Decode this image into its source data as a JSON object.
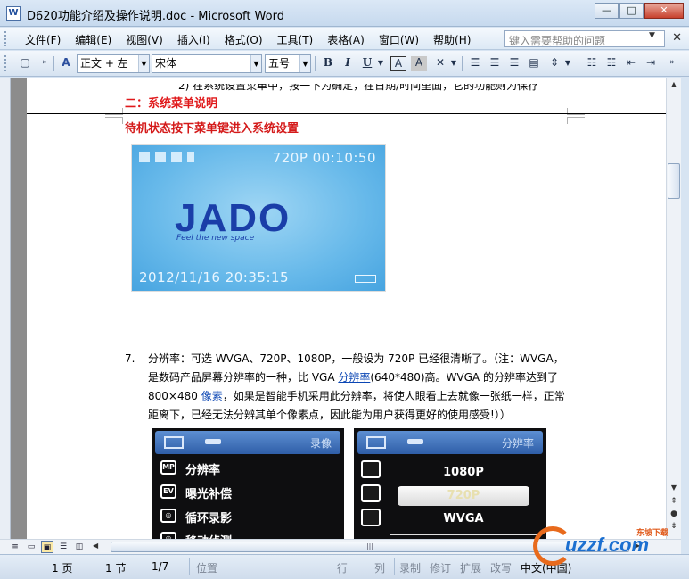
{
  "window": {
    "title": "D620功能介绍及操作说明.doc - Microsoft Word",
    "app_icon": "W",
    "buttons": {
      "minimize": "—",
      "maximize": "□",
      "close": "✕"
    }
  },
  "menubar": {
    "items": [
      "文件(F)",
      "编辑(E)",
      "视图(V)",
      "插入(I)",
      "格式(O)",
      "工具(T)",
      "表格(A)",
      "窗口(W)",
      "帮助(H)"
    ],
    "help_placeholder": "键入需要帮助的问题",
    "close": "✕"
  },
  "toolbar": {
    "style_value": "正文 + 左",
    "font_value": "宋体",
    "size_value": "五号",
    "bold": "B",
    "italic": "I",
    "underline": "U",
    "char_border": "A",
    "char_shade": "A"
  },
  "document": {
    "prev_line": "2)    在系统设置菜单中，按一下为确定，在日期/时间里面，它的功能则为保存",
    "heading2": "二：系统菜单说明",
    "heading3": "待机状态按下菜单键进入系统设置",
    "screen1": {
      "resolution_time": "720P 00:10:50",
      "logo": "JADO",
      "tagline": "Feel the new space",
      "datetime": "2012/11/16 20:35:15"
    },
    "item7": {
      "number": "7.",
      "text_part1": "分辨率：可选 WVGA、720P、1080P，一般设为 720P 已经很清晰了。（注：WVGA，是数码产品屏幕分辨率的一种，比 VGA ",
      "link1": "分辨率",
      "text_part2": "(640*480)高。WVGA 的分辨率达到了 800×480 ",
      "link2": "像素",
      "text_part3": "，如果是智能手机采用此分辨率，将使人眼看上去就像一张纸一样，正常距离下，已经无法分辨其单个像素点，因此能为用户获得更好的使用感受!））"
    },
    "screen2": {
      "header_title": "录像",
      "rows": [
        {
          "icon": "MP",
          "label": "分辨率"
        },
        {
          "icon": "EV",
          "label": "曝光补偿"
        },
        {
          "icon": "◎",
          "label": "循环录影"
        },
        {
          "icon": "◎",
          "label": "移动侦测"
        }
      ]
    },
    "screen3": {
      "header_title": "分辨率",
      "options": [
        "1080P",
        "720P",
        "WVGA"
      ],
      "selected": "720P"
    }
  },
  "statusbar": {
    "page": "1 页",
    "section": "1 节",
    "page_of": "1/7",
    "position": "位置",
    "line": "行",
    "col": "列",
    "rec": "录制",
    "trk": "修订",
    "ext": "扩展",
    "ovr": "改写",
    "lang": "中文(中国)"
  },
  "watermark": {
    "text": "uzzf.com",
    "sub": "东坡下载"
  }
}
